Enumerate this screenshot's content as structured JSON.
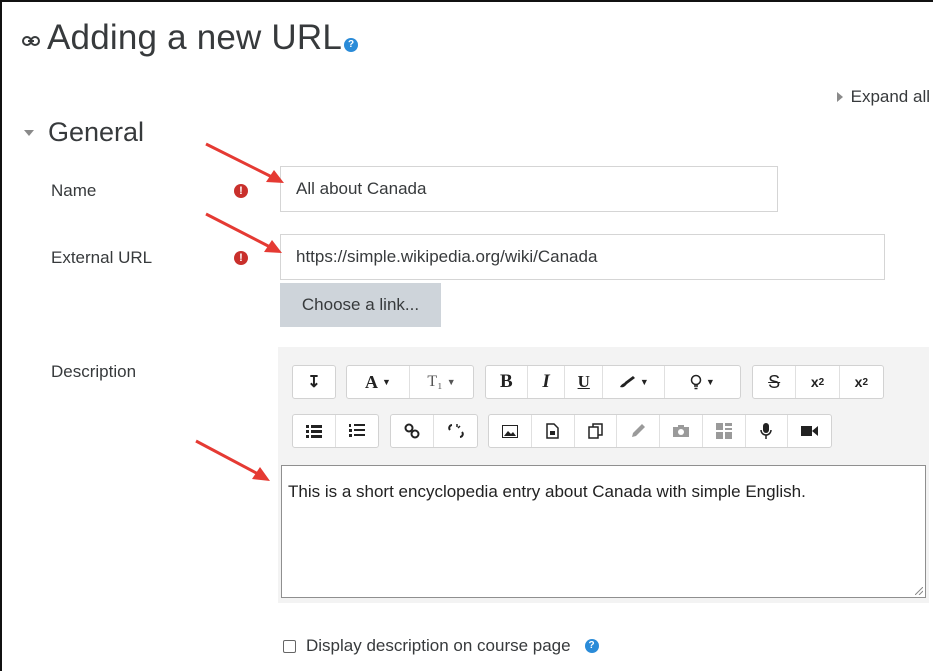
{
  "page": {
    "title": "Adding a new URL",
    "expand_all": "Expand all",
    "section": "General"
  },
  "form": {
    "name_label": "Name",
    "name_value": "All about Canada",
    "url_label": "External URL",
    "url_value": "https://simple.wikipedia.org/wiki/Canada",
    "choose_link": "Choose a link...",
    "description_label": "Description",
    "description_value": "This is a short encyclopedia entry about Canada with simple English.",
    "display_description": "Display description on course page",
    "required_mark": "!",
    "help_mark": "?"
  },
  "toolbar": {
    "row1": [
      {
        "name": "toggle-toolbar-button",
        "glyph": "↴"
      },
      {
        "name": "font-family-button",
        "glyph": "A"
      },
      {
        "name": "font-size-button",
        "glyph": "T₁"
      },
      {
        "name": "bold-button",
        "glyph": "B"
      },
      {
        "name": "italic-button",
        "glyph": "I"
      },
      {
        "name": "underline-button",
        "glyph": "U"
      },
      {
        "name": "font-color-button",
        "glyph": "✎"
      },
      {
        "name": "background-color-button",
        "glyph": "♀"
      },
      {
        "name": "strikethrough-button",
        "glyph": "S"
      },
      {
        "name": "subscript-button",
        "glyph": "x₂"
      },
      {
        "name": "superscript-button",
        "glyph": "x²"
      }
    ],
    "row2": [
      {
        "name": "unordered-list-button",
        "glyph": "☰"
      },
      {
        "name": "ordered-list-button",
        "glyph": "≡"
      },
      {
        "name": "link-button",
        "glyph": "∞"
      },
      {
        "name": "unlink-button",
        "glyph": "✂"
      },
      {
        "name": "image-button",
        "glyph": "▣"
      },
      {
        "name": "media-button",
        "glyph": "▤"
      },
      {
        "name": "manage-files-button",
        "glyph": "❐"
      },
      {
        "name": "draw-button",
        "glyph": "✏"
      },
      {
        "name": "screenshot-button",
        "glyph": "■"
      },
      {
        "name": "template-button",
        "glyph": "▦"
      },
      {
        "name": "record-audio-button",
        "glyph": "●"
      },
      {
        "name": "record-video-button",
        "glyph": "▶"
      }
    ]
  },
  "colors": {
    "required": "#c9302c",
    "help": "#2a8bd8",
    "arrow": "#e53a33",
    "button_grey": "#ced4da"
  }
}
